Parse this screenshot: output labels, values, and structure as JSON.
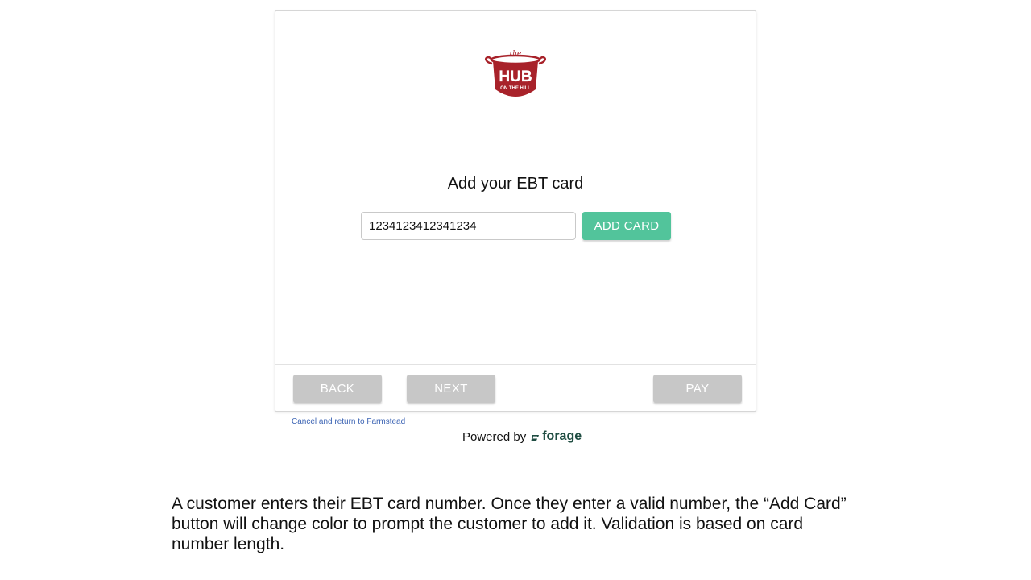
{
  "logo": {
    "top_word": "the",
    "main_word": "HUB",
    "sub_word": "ON THE HILL",
    "color": "#a8222a"
  },
  "card": {
    "title": "Add your EBT card",
    "card_number_value": "1234123412341234",
    "add_button_label": "ADD CARD",
    "add_button_color": "#52c49b"
  },
  "footer": {
    "back_label": "BACK",
    "next_label": "NEXT",
    "pay_label": "PAY",
    "disabled_color": "#c7c7c7"
  },
  "links": {
    "cancel_text": "Cancel and return to Farmstead"
  },
  "powered_by": {
    "prefix": "Powered by",
    "brand": "forage",
    "brand_icon": "forage-icon",
    "brand_color": "#1f4d42"
  },
  "caption": {
    "text": "A customer enters their EBT card number. Once they enter a valid number, the “Add Card” button will change color to prompt the customer to add it. Validation is based on card number length."
  }
}
